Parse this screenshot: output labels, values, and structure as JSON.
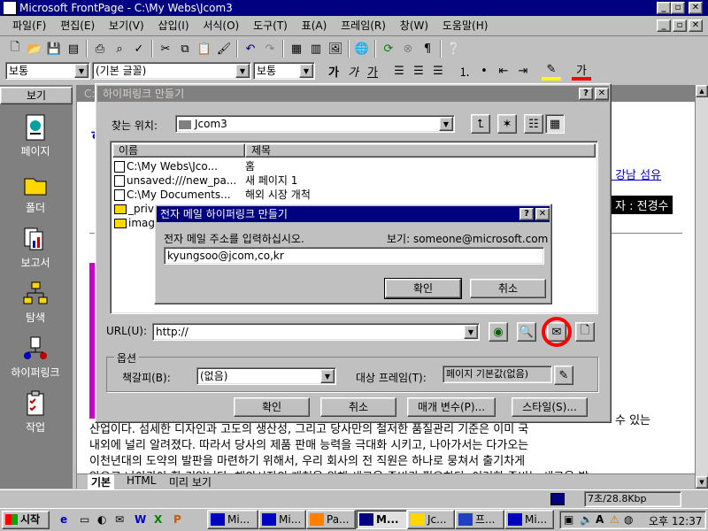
{
  "app": {
    "title": "Microsoft FrontPage - C:\\My Webs\\Jcom3"
  },
  "menu": [
    "파일(F)",
    "편집(E)",
    "보기(V)",
    "삽입(I)",
    "서식(O)",
    "도구(T)",
    "표(A)",
    "프레임(R)",
    "창(W)",
    "도움말(H)"
  ],
  "format_bar": {
    "style": "보통",
    "font": "(기본 글꼴)",
    "size": "보통",
    "bold": "가",
    "italic": "가",
    "underline": "가",
    "color_label": "가"
  },
  "views_bar": {
    "header": "보기",
    "items": [
      {
        "label": "페이지",
        "icon": "page-icon"
      },
      {
        "label": "폴더",
        "icon": "folder-icon"
      },
      {
        "label": "보고서",
        "icon": "report-icon"
      },
      {
        "label": "탐색",
        "icon": "navigation-icon"
      },
      {
        "label": "하이퍼링크",
        "icon": "hyperlink-icon"
      },
      {
        "label": "작업",
        "icon": "tasks-icon"
      }
    ]
  },
  "editor": {
    "tab_path": "C:",
    "right_text1": "양 강남 섬유",
    "right_text2": "자 : 전경수",
    "right_text3": "수 있는",
    "body_lines": [
      "산업이다. 섬세한 디자인과 고도의 생산성, 그리고 당사만의 철저한 품질관리 기준은 이미 국",
      "내외에 널리 알려졌다. 따라서 당사의 제품 판매 능력을 극대화 시키고, 나아가서는 다가오는",
      "이천년대의 도약의 발판을 마련하기 위해서, 우리 회사의 전 직원은 하나로 뭉쳐서 출기차게",
      "앞으로 나아가야 할 것입니다. 해외시장의 개척을 위해 새로운 준비가 필요하다. 이러한 준비는 새로운 발"
    ],
    "tabs": [
      "기본",
      "HTML",
      "미리 보기"
    ]
  },
  "hyperlink_dialog": {
    "title": "하이퍼링크 만들기",
    "look_in_label": "찾는 위치:",
    "look_in_value": "Jcom3",
    "columns": [
      "이름",
      "제목"
    ],
    "files": [
      {
        "name": "C:\\My Webs\\Jco...",
        "title": "홈",
        "type": "page"
      },
      {
        "name": "unsaved:///new_pa...",
        "title": "새 페이지 1",
        "type": "page"
      },
      {
        "name": "C:\\My Documents...",
        "title": "해외 시장 개척",
        "type": "page"
      },
      {
        "name": "_priv",
        "title": "",
        "type": "folder"
      },
      {
        "name": "imag",
        "title": "",
        "type": "folder"
      }
    ],
    "url_label": "URL(U):",
    "url_value": "http://",
    "options_label": "옵션",
    "bookmark_label": "책갈피(B):",
    "bookmark_value": "(없음)",
    "target_label": "대상 프레임(T):",
    "target_value": "페이지 기본값(없음)",
    "buttons": [
      "확인",
      "취소",
      "매개 변수(P)...",
      "스타일(S)..."
    ]
  },
  "email_dialog": {
    "title": "전자 메일 하이퍼링크 만들기",
    "prompt": "전자 메일 주소를 입력하십시오.",
    "example": "보기: someone@microsoft.com",
    "value": "kyungsoo@jcom,co,kr",
    "ok": "확인",
    "cancel": "취소"
  },
  "status_bar": {
    "speed": "7초/28.8Kbp"
  },
  "taskbar": {
    "start": "시작",
    "tasks": [
      "Mi...",
      "Mi...",
      "Pa...",
      "M...",
      "Jc...",
      "프...",
      "Mi..."
    ],
    "clock": "오후 12:37"
  },
  "colors": {
    "titlebar": "#000080",
    "desktop": "#c0c0c0",
    "highlight_circle": "#ff0000",
    "magenta_bar": "#cc00cc"
  }
}
